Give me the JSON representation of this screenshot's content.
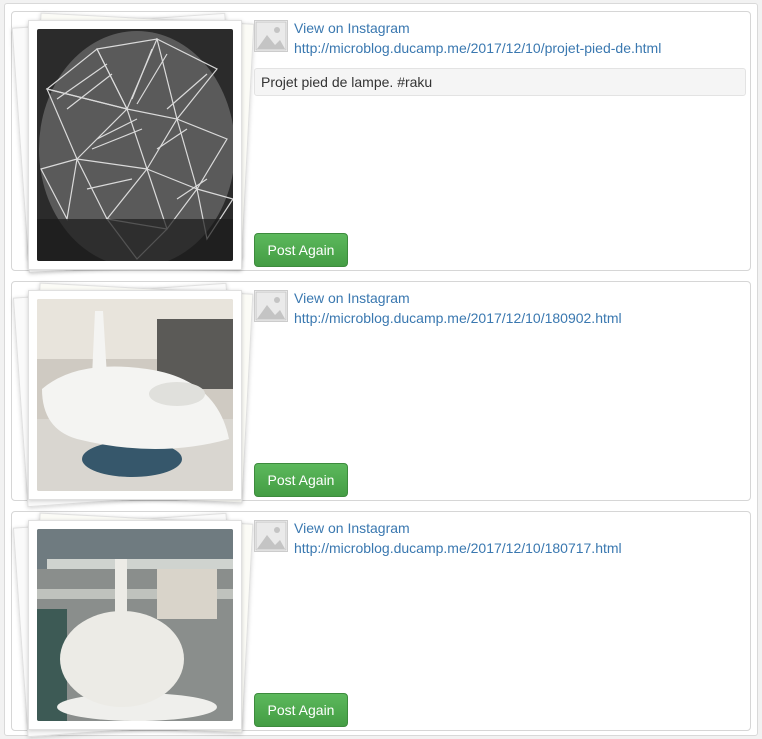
{
  "posts": [
    {
      "view_label": "View on Instagram",
      "url": "http://microblog.ducamp.me/2017/12/10/projet-pied-de.html",
      "caption": "Projet pied de lampe. #raku",
      "button": "Post Again",
      "photo_icon": "image-placeholder-icon"
    },
    {
      "view_label": "View on Instagram",
      "url": "http://microblog.ducamp.me/2017/12/10/180902.html",
      "button": "Post Again",
      "photo_icon": "image-placeholder-icon"
    },
    {
      "view_label": "View on Instagram",
      "url": "http://microblog.ducamp.me/2017/12/10/180717.html",
      "button": "Post Again",
      "photo_icon": "image-placeholder-icon"
    }
  ],
  "colors": {
    "link": "#3a78b0",
    "button": "#4cae4c"
  }
}
